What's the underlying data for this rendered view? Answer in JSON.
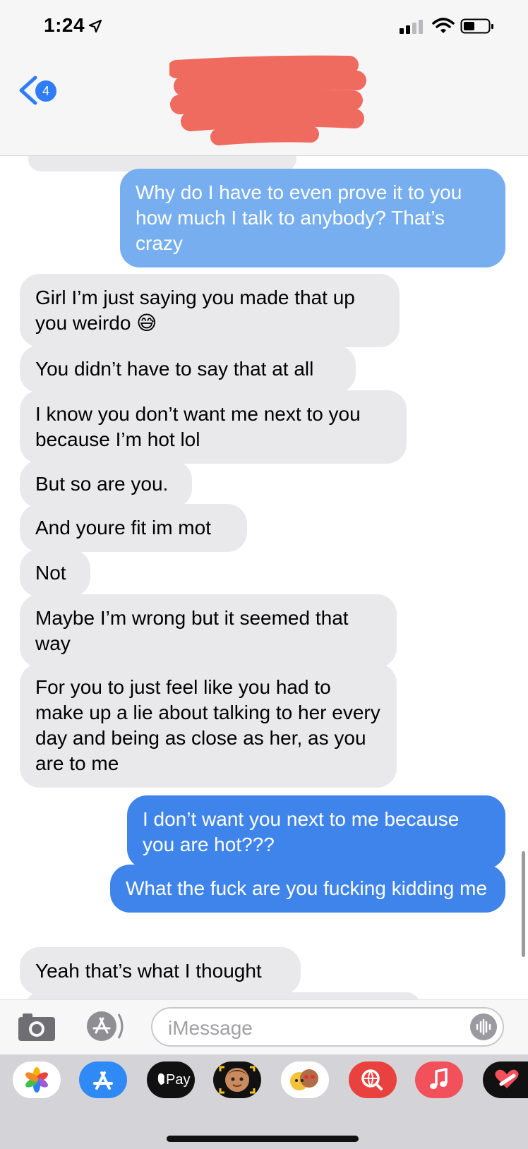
{
  "status_bar": {
    "time": "1:24"
  },
  "nav": {
    "back_badge": "4",
    "contact_name_redacted": true
  },
  "messages": [
    {
      "from": "me",
      "text": "Why do I have to even prove it to you how much I talk to anybody? That’s crazy"
    },
    {
      "from": "them",
      "text": "Girl I’m just saying you made that up you weirdo 😅"
    },
    {
      "from": "them",
      "text": "You didn’t have to say that at all"
    },
    {
      "from": "them",
      "text": "I know you don’t want me next to you because I’m hot lol"
    },
    {
      "from": "them",
      "text": "But so are you."
    },
    {
      "from": "them",
      "text": "And youre fit im mot"
    },
    {
      "from": "them",
      "text": "Not"
    },
    {
      "from": "them",
      "text": "Maybe I’m wrong but it seemed that way"
    },
    {
      "from": "them",
      "text": "For you to just feel like you had to make up a lie about talking to her every day and being as close as her, as you are to me"
    },
    {
      "from": "me",
      "text": "I don’t want you next to me because you are hot???"
    },
    {
      "from": "me",
      "text": "What the fuck are you fucking kidding me"
    },
    {
      "from": "them",
      "text": "Yeah that’s what I thought"
    }
  ],
  "input": {
    "placeholder": "iMessage"
  },
  "drawer": {
    "apps": [
      "photos-icon",
      "app-store-icon",
      "apple-pay-icon",
      "memoji-icon",
      "animoji-stickers-icon",
      "web-search-icon",
      "music-icon",
      "digital-touch-icon"
    ],
    "apple_pay_label": "Pay"
  },
  "colors": {
    "incoming": "#e9e9eb",
    "outgoing_light": "#76aef0",
    "outgoing": "#3f84ea",
    "badge": "#2f7cf6",
    "redaction": "#ef6a5f"
  }
}
